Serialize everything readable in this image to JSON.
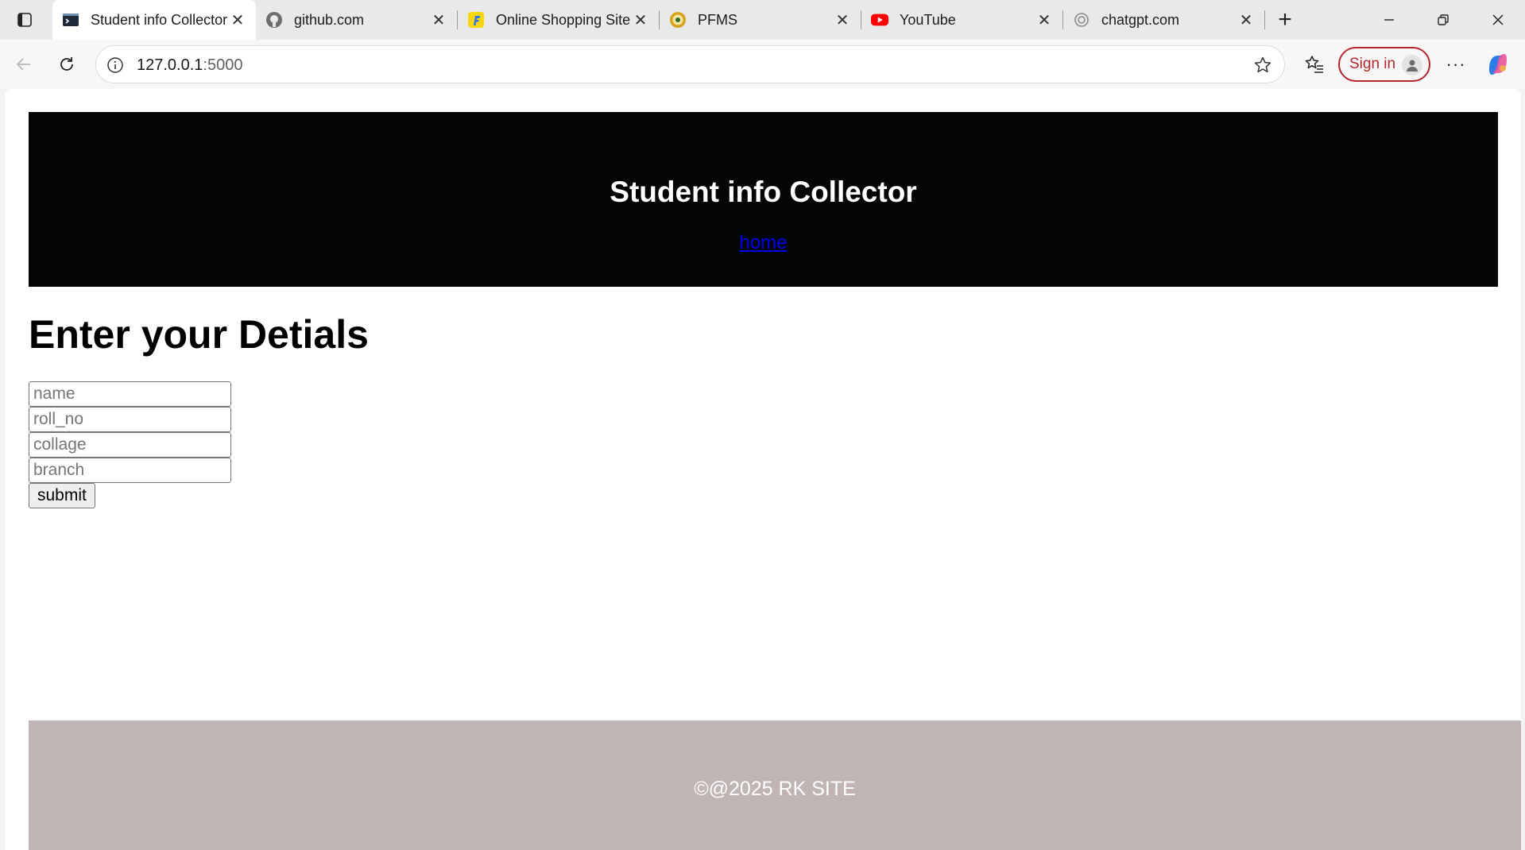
{
  "browser": {
    "tabs": [
      {
        "title": "Student info Collector",
        "active": true,
        "icon": "terminal-icon"
      },
      {
        "title": "github.com",
        "active": false,
        "icon": "github-icon"
      },
      {
        "title": "Online Shopping Site",
        "active": false,
        "icon": "flipkart-icon"
      },
      {
        "title": "PFMS",
        "active": false,
        "icon": "pfms-emblem-icon"
      },
      {
        "title": "YouTube",
        "active": false,
        "icon": "youtube-icon"
      },
      {
        "title": "chatgpt.com",
        "active": false,
        "icon": "openai-icon"
      }
    ],
    "url_host": "127.0.0.1",
    "url_port": ":5000",
    "sign_in_label": "Sign in"
  },
  "header": {
    "title": "Student info Collector",
    "nav_link": "home"
  },
  "form": {
    "heading": "Enter your Detials",
    "fields": [
      {
        "name": "name",
        "placeholder": "name"
      },
      {
        "name": "roll_no",
        "placeholder": "roll_no"
      },
      {
        "name": "collage",
        "placeholder": "collage"
      },
      {
        "name": "branch",
        "placeholder": "branch"
      }
    ],
    "submit_label": "submit"
  },
  "footer": {
    "text": "©@2025 RK SITE"
  },
  "colors": {
    "header_bg": "#040606",
    "footer_bg": "#c1b4b4",
    "link": "#0000ee",
    "signin_accent": "#b1262f"
  }
}
